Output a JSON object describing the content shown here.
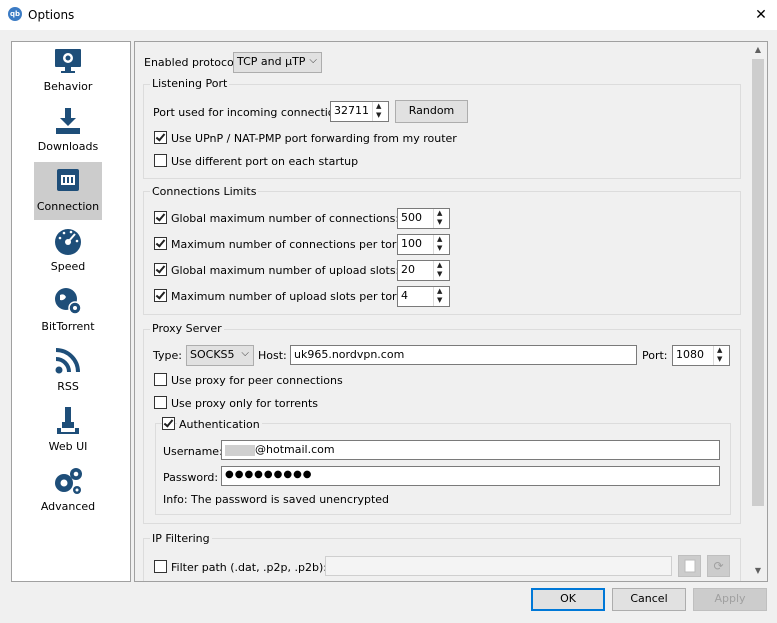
{
  "window": {
    "title": "Options",
    "app_icon": "qb",
    "close_glyph": "✕"
  },
  "sidebar": {
    "items": [
      {
        "label": "Behavior",
        "icon": "monitor-gear-icon"
      },
      {
        "label": "Downloads",
        "icon": "download-icon"
      },
      {
        "label": "Connection",
        "icon": "network-icon"
      },
      {
        "label": "Speed",
        "icon": "speedometer-icon"
      },
      {
        "label": "BitTorrent",
        "icon": "globe-gear-icon"
      },
      {
        "label": "RSS",
        "icon": "rss-icon"
      },
      {
        "label": "Web UI",
        "icon": "plug-icon"
      },
      {
        "label": "Advanced",
        "icon": "gears-icon"
      }
    ],
    "selected": "Connection"
  },
  "protocol": {
    "label": "Enabled protocol:",
    "value": "TCP and µTP"
  },
  "listening_port": {
    "title": "Listening Port",
    "port_label": "Port used for incoming connections:",
    "port_value": "32711",
    "random_button": "Random",
    "upnp_label": "Use UPnP / NAT-PMP port forwarding from my router",
    "upnp_checked": true,
    "diff_port_label": "Use different port on each startup",
    "diff_port_checked": false
  },
  "connection_limits": {
    "title": "Connections Limits",
    "rows": [
      {
        "label": "Global maximum number of connections:",
        "value": "500",
        "checked": true
      },
      {
        "label": "Maximum number of connections per torrent:",
        "value": "100",
        "checked": true
      },
      {
        "label": "Global maximum number of upload slots:",
        "value": "20",
        "checked": true
      },
      {
        "label": "Maximum number of upload slots per torrent:",
        "value": "4",
        "checked": true
      }
    ]
  },
  "proxy": {
    "title": "Proxy Server",
    "type_label": "Type:",
    "type_value": "SOCKS5",
    "host_label": "Host:",
    "host_value": "uk965.nordvpn.com",
    "port_label": "Port:",
    "port_value": "1080",
    "peer_label": "Use proxy for peer connections",
    "peer_checked": false,
    "torrents_label": "Use proxy only for torrents",
    "torrents_checked": false,
    "auth": {
      "label": "Authentication",
      "checked": true,
      "username_label": "Username:",
      "username_value": "@hotmail.com",
      "password_label": "Password:",
      "password_value": "●●●●●●●●●",
      "info": "Info: The password is saved unencrypted"
    }
  },
  "ip_filtering": {
    "title": "IP Filtering",
    "filter_label": "Filter path (.dat, .p2p, .p2b):",
    "filter_checked": false,
    "filter_value": ""
  },
  "footer": {
    "ok": "OK",
    "cancel": "Cancel",
    "apply": "Apply"
  },
  "colors": {
    "selected_bg": "#cccccc",
    "icon_blue": "#1e4e79",
    "default_btn_border": "#0078d7"
  }
}
